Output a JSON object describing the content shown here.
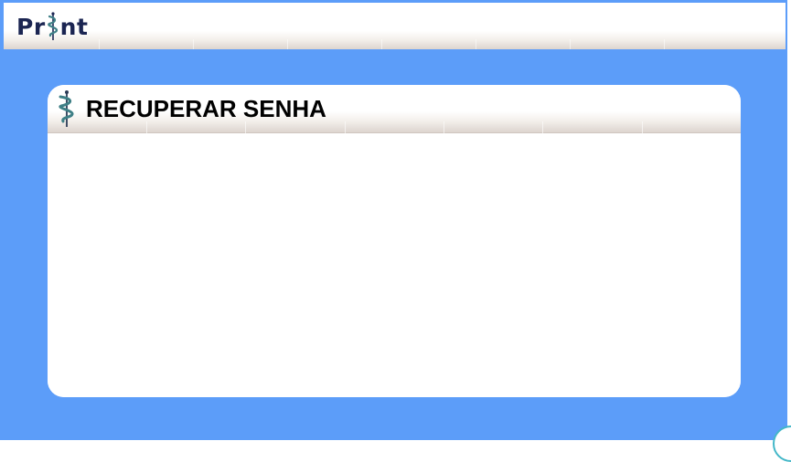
{
  "app": {
    "logo_text_left": "Pr",
    "logo_text_right": "nt",
    "logo_mark": "caduceus-icon"
  },
  "card": {
    "title": "RECUPERAR SENHA",
    "title_icon": "caduceus-icon"
  },
  "colors": {
    "background": "#5c9df9",
    "logo_text": "#1b2552",
    "logo_mark": "#3e7f86",
    "card": "#ffffff",
    "corner_badge_border": "#43b7c8"
  }
}
